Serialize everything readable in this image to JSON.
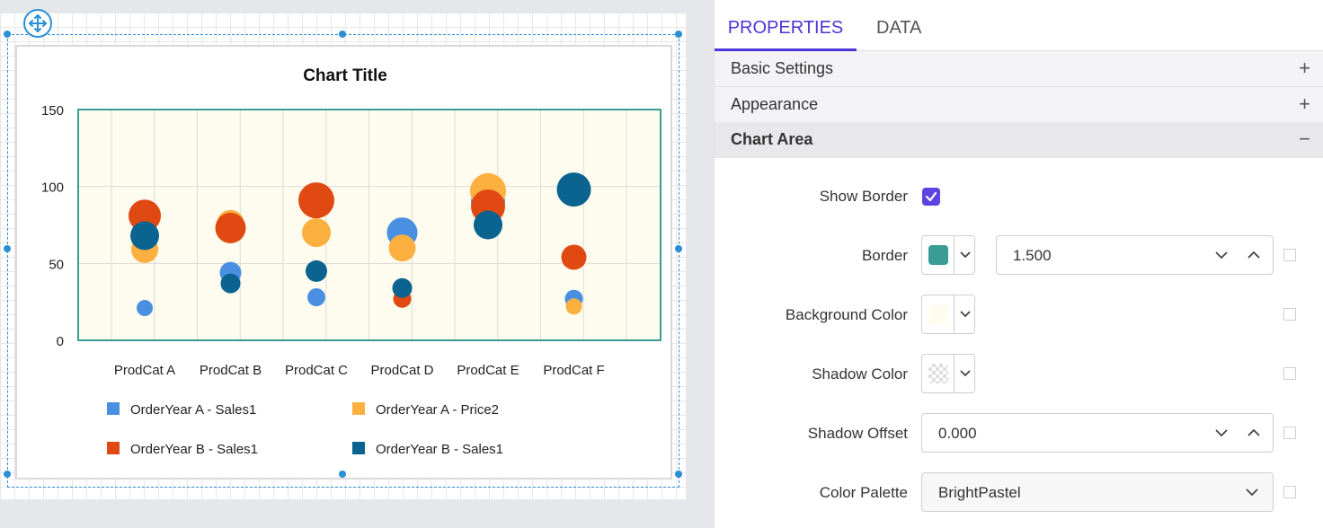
{
  "chart_data": {
    "type": "scatter",
    "title": "Chart Title",
    "categories": [
      "ProdCat A",
      "ProdCat B",
      "ProdCat C",
      "ProdCat D",
      "ProdCat E",
      "ProdCat F"
    ],
    "ylim": [
      0,
      150
    ],
    "yticks": [
      "0",
      "50",
      "100",
      "150"
    ],
    "grid": true,
    "legend_position": "bottom",
    "plot_background": "#fefcef",
    "plot_border": "#3a9c94",
    "series": [
      {
        "name": "OrderYear A - Sales1",
        "color": "#4a90e2",
        "values": [
          21,
          44,
          28,
          70,
          90,
          27
        ],
        "sizes": [
          9,
          12,
          10,
          17,
          19,
          10
        ]
      },
      {
        "name": "OrderYear A - Price2",
        "color": "#fbb040",
        "values": [
          59,
          76,
          70,
          60,
          97,
          22
        ],
        "sizes": [
          15,
          15,
          16,
          15,
          20,
          9
        ]
      },
      {
        "name": "OrderYear B - Sales1",
        "color": "#e04a12",
        "values": [
          81,
          73,
          91,
          27,
          87,
          54
        ],
        "sizes": [
          18,
          17,
          20,
          10,
          19,
          14
        ]
      },
      {
        "name": "OrderYear B - Sales1",
        "color": "#0b6390",
        "values": [
          68,
          37,
          45,
          34,
          75,
          98
        ],
        "sizes": [
          16,
          11,
          12,
          11,
          16,
          19
        ]
      }
    ]
  },
  "panel": {
    "tabs": [
      "PROPERTIES",
      "DATA"
    ],
    "sections": {
      "basic": {
        "label": "Basic Settings",
        "toggle": "+"
      },
      "appearance": {
        "label": "Appearance",
        "toggle": "+"
      },
      "chart_area": {
        "label": "Chart Area",
        "toggle": "−"
      }
    },
    "show_border": {
      "label": "Show Border",
      "checked": true
    },
    "border": {
      "label": "Border",
      "color": "#3a9c94",
      "width": "1.500"
    },
    "background_color": {
      "label": "Background Color",
      "color": "#fefcef"
    },
    "shadow_color": {
      "label": "Shadow Color",
      "color": "transparent"
    },
    "shadow_offset": {
      "label": "Shadow Offset",
      "value": "0.000"
    },
    "color_palette": {
      "label": "Color Palette",
      "value": "BrightPastel"
    }
  }
}
